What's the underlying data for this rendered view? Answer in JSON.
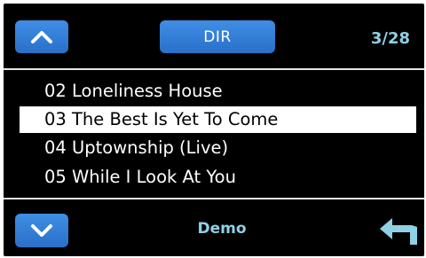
{
  "header": {
    "dir_label": "DIR",
    "counter": "3/28"
  },
  "tracks": [
    {
      "label": "02 Loneliness House",
      "selected": false
    },
    {
      "label": "03 The Best Is Yet To Come",
      "selected": true
    },
    {
      "label": "04 Uptownship (Live)",
      "selected": false
    },
    {
      "label": "05 While I Look At You",
      "selected": false
    }
  ],
  "footer": {
    "folder_name": "Demo"
  },
  "icons": {
    "up": "chevron-up-icon",
    "down": "chevron-down-icon",
    "back": "return-arrow-icon"
  },
  "colors": {
    "background": "#000000",
    "button": "#3a86df",
    "accent_text": "#8fd0e6",
    "selection": "#ffffff"
  }
}
